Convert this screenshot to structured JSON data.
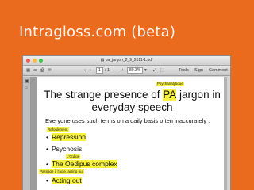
{
  "slide": {
    "title": "Intragloss.com (beta)"
  },
  "window": {
    "filename": "pa_jargon_2_9_2011-1.pdf",
    "traffic_colors": [
      "#f25b55",
      "#f7bd3c",
      "#3cc84a"
    ]
  },
  "toolbar": {
    "nav_back": "‹",
    "nav_forward": "›",
    "page_current": "1",
    "page_total": "/ 1",
    "zoom": "80.3%",
    "tools": "Tools",
    "sign": "Sign",
    "comment": "Comment"
  },
  "document": {
    "title_line1_before": "The strange presence of",
    "title_line1_highlight": "PA",
    "title_line1_after": "jargon in",
    "title_line2": "everyday speech",
    "intro": "Everyone uses such terms on a daily basis often inaccurately :",
    "annotations": {
      "psychoanalytic": "Psychanalytique",
      "repression": "Refoulement",
      "oedipus": "L'Œdipe",
      "acting_out": "Passage à l'acte, acting out"
    },
    "bullets": {
      "repression": "Repression",
      "psychosis": "Psychosis",
      "oedipus": "The Oedipus complex",
      "acting_out": "Acting out"
    }
  }
}
